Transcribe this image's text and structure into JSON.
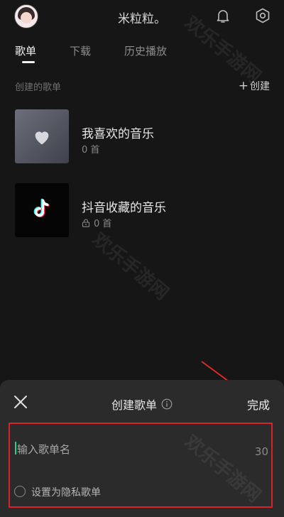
{
  "header": {
    "nickname": "米粒粒。",
    "icons": [
      "avatar",
      "bell-icon",
      "settings-icon"
    ]
  },
  "tabs": [
    {
      "label": "歌单",
      "active": true
    },
    {
      "label": "下载",
      "active": false
    },
    {
      "label": "历史播放",
      "active": false
    }
  ],
  "section": {
    "title": "创建的歌单",
    "create_label": "创建",
    "create_icon": "plus-icon"
  },
  "playlists": [
    {
      "title": "我喜欢的音乐",
      "count": "0 首",
      "cover_icon": "heart-icon",
      "locked": false
    },
    {
      "title": "抖音收藏的音乐",
      "count": "0 首",
      "cover_icon": "tiktok-logo",
      "locked": true
    }
  ],
  "sheet": {
    "title": "创建歌单",
    "done_label": "完成",
    "input_placeholder": "输入歌单名",
    "char_limit": "30",
    "private_label": "设置为隐私歌单"
  },
  "watermark": "欢乐手游网",
  "colors": {
    "background": "#161616",
    "sheet": "#2b2b2b",
    "highlight": "#d4232b",
    "cursor": "#35c98a"
  }
}
